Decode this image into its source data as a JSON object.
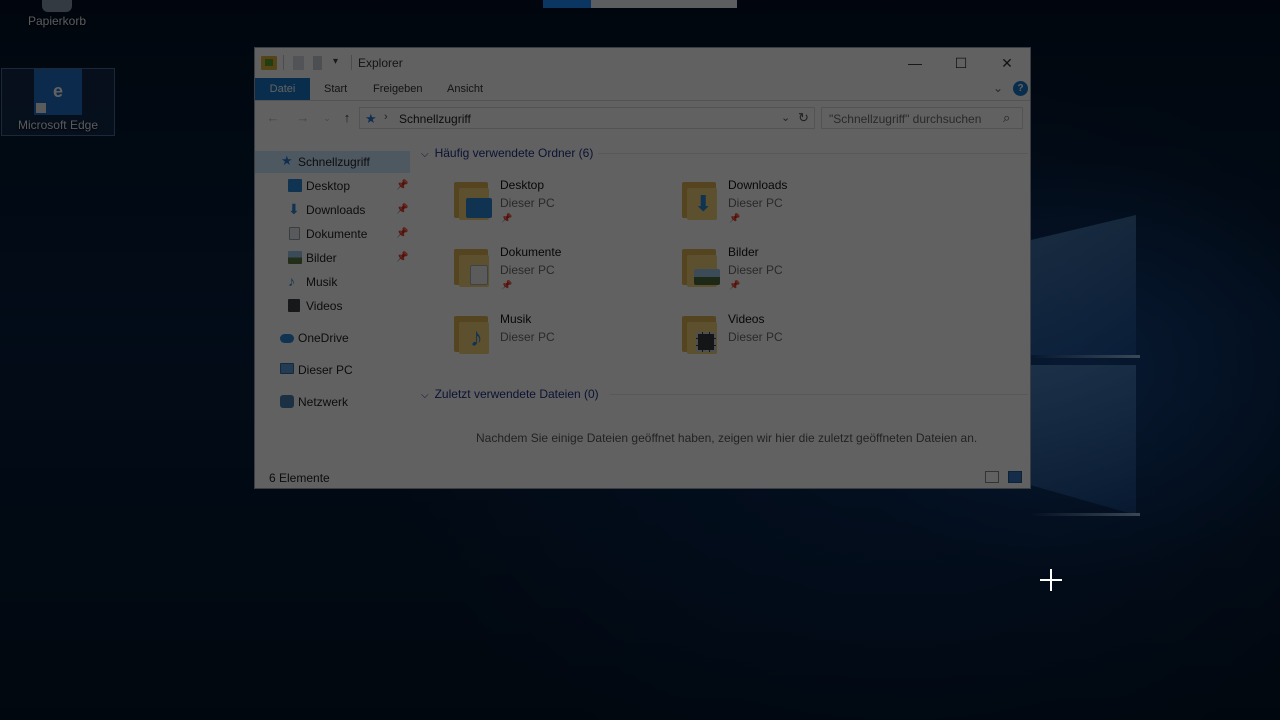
{
  "desktop": {
    "icons": [
      {
        "label": "Papierkorb"
      },
      {
        "label": "Microsoft Edge",
        "glyph": "e"
      }
    ]
  },
  "explorer": {
    "title": "Explorer",
    "qa_dropdown": "▾",
    "window_controls": {
      "minimize": "—",
      "maximize": "☐",
      "close": "✕"
    },
    "ribbon": {
      "tabs": [
        "Datei",
        "Start",
        "Freigeben",
        "Ansicht"
      ],
      "expand": "⌄",
      "help": "?"
    },
    "nav": {
      "back": "←",
      "forward": "→",
      "recent": "⌄",
      "up": "↑",
      "address": {
        "chevron": "›",
        "path": "Schnellzugriff",
        "dropdown": "⌄",
        "refresh": "↻"
      },
      "search_placeholder": "\"Schnellzugriff\" durchsuchen"
    },
    "sidebar": {
      "items": [
        {
          "label": "Schnellzugriff",
          "icon": "star-icon",
          "selected": true
        },
        {
          "label": "Desktop",
          "icon": "desktop-icon",
          "pinned": true
        },
        {
          "label": "Downloads",
          "icon": "download-icon",
          "pinned": true
        },
        {
          "label": "Dokumente",
          "icon": "document-icon",
          "pinned": true
        },
        {
          "label": "Bilder",
          "icon": "pictures-icon",
          "pinned": true
        },
        {
          "label": "Musik",
          "icon": "music-icon"
        },
        {
          "label": "Videos",
          "icon": "video-icon"
        },
        {
          "label": "OneDrive",
          "icon": "cloud-icon"
        },
        {
          "label": "Dieser PC",
          "icon": "computer-icon"
        },
        {
          "label": "Netzwerk",
          "icon": "network-icon"
        }
      ]
    },
    "content": {
      "frequent_header": "Häufig verwendete Ordner (6)",
      "frequent": [
        {
          "name": "Desktop",
          "location": "Dieser PC",
          "pinned": true
        },
        {
          "name": "Downloads",
          "location": "Dieser PC",
          "pinned": true
        },
        {
          "name": "Dokumente",
          "location": "Dieser PC",
          "pinned": true
        },
        {
          "name": "Bilder",
          "location": "Dieser PC",
          "pinned": true
        },
        {
          "name": "Musik",
          "location": "Dieser PC",
          "pinned": false
        },
        {
          "name": "Videos",
          "location": "Dieser PC",
          "pinned": false
        }
      ],
      "recent_header": "Zuletzt verwendete Dateien (0)",
      "empty_message": "Nachdem Sie einige Dateien geöffnet haben, zeigen wir hier die zuletzt geöffneten Dateien an."
    },
    "status": {
      "count": "6 Elemente"
    }
  },
  "colors": {
    "accent": "#1979ca",
    "group_header": "#1e3287",
    "folder": "#f3d27a"
  }
}
